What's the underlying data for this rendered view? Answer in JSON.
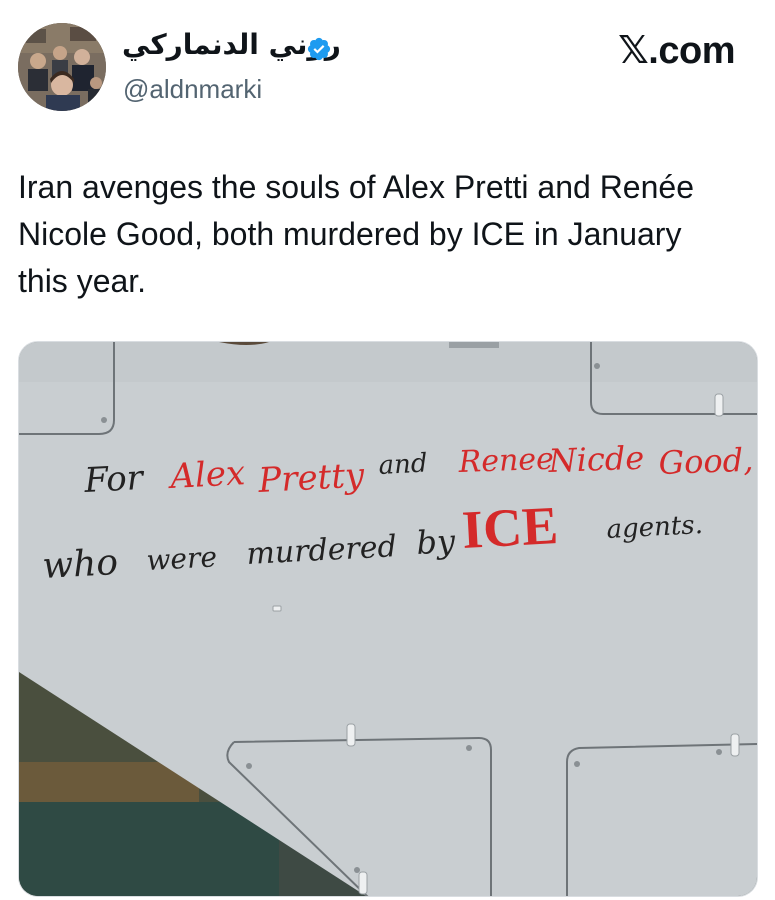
{
  "post": {
    "author": {
      "display_name": "روني الدنماركي",
      "handle": "@aldnmarki",
      "verified": true,
      "avatar_icon": "avatar-photo"
    },
    "brand": {
      "x_letter": "𝕏",
      "suffix": ".com"
    },
    "text": "Iran avenges the souls of Alex Pretti and Renée Nicole Good, both murdered by ICE in January this year.",
    "media": {
      "alt": "photo of drone wing with handwritten message",
      "line1": {
        "w1": "For",
        "w2": "Alex",
        "w3": "Pretty",
        "w4": "and",
        "w5": "Renee",
        "w6": "Nicde",
        "w7": "Good,"
      },
      "line2": {
        "w1": "who",
        "w2": "were",
        "w3": "murdered",
        "w4": "by",
        "w5": "ICE",
        "w6": "agents."
      }
    }
  },
  "colors": {
    "verified": "#1d9bf0",
    "marker_red": "#d42a2a",
    "marker_black": "#222222",
    "panel": "#c9ced1"
  }
}
